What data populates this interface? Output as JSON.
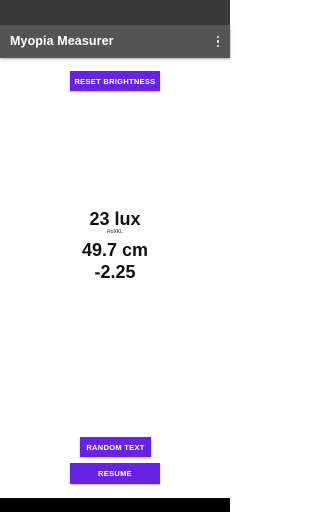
{
  "app_bar": {
    "title": "Myopia Measurer",
    "overflow_icon": "more-vert-icon"
  },
  "buttons": {
    "reset_brightness": "RESET BRIGHTNESS",
    "random_text": "RANDOM TEXT",
    "resume": "RESUME"
  },
  "readings": {
    "lux": "23 lux",
    "sample_text": "RoXKL",
    "distance": "49.7 cm",
    "diopter": "-2.25"
  },
  "colors": {
    "status_bar": "#3a3a3a",
    "app_bar": "#545454",
    "button": "#6723e2",
    "background": "#ffffff",
    "nav_bar": "#000000"
  }
}
